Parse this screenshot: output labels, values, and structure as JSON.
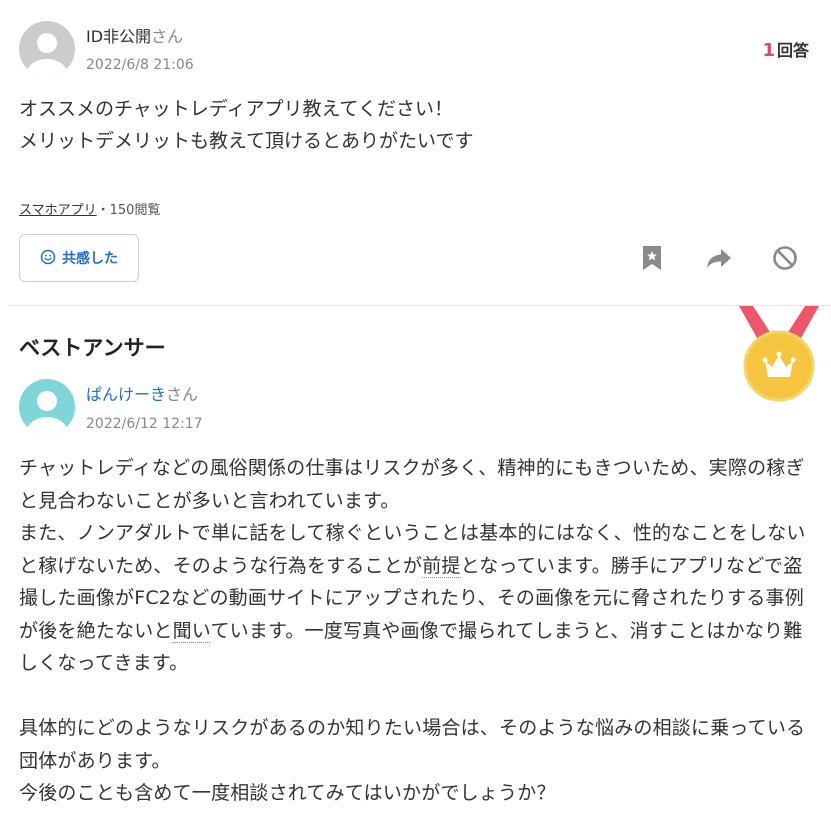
{
  "question": {
    "user_name": "ID非公開",
    "user_suffix": "さん",
    "date": "2022/6/8 21:06",
    "answer_count": "1",
    "answer_label": "回答",
    "body": "オススメのチャットレディアプリ教えてください！\nメリットデメリットも教えて頂けるとありがたいです",
    "category": "スマホアプリ",
    "separator": "・",
    "views": "150閲覧",
    "empathy_label": "共感した",
    "icons": [
      "bookmark-icon",
      "share-icon",
      "block-icon"
    ]
  },
  "best_answer": {
    "title": "ベストアンサー",
    "medal_icon": "crown-medal-icon",
    "user_name": "ぱんけーき",
    "user_suffix": "さん",
    "date": "2022/6/12 12:17",
    "paragraphs": {
      "p1": "チャットレディなどの風俗関係の仕事はリスクが多く、精神的にもきついため、実際の稼ぎと見合わないことが多いと言われています。",
      "p2_a": "また、ノンアダルトで単に話をして稼ぐということは基本的にはなく、性的なことをしないと稼げないため、そのような行為をすることが",
      "p2_link1": "前提",
      "p2_b": "となっています。勝手にアプリなどで盗撮した画像がFC2などの動画サイトにアップされたり、その画像を元に脅されたりする事例が後を絶たないと",
      "p2_link2": "聞い",
      "p2_c": "ています。一度写真や画像で撮られてしまうと、消すことはかなり難しくなってきます。",
      "p3": "具体的にどのようなリスクがあるのか知りたい場合は、そのような悩みの相談に乗っている団体があります。",
      "p4": "今後のことも含めて一度相談されてみてはいかがでしょうか？"
    }
  },
  "colors": {
    "accent_red": "#e0455d",
    "link_blue": "#1f6fc5",
    "medal_gold": "#f5c53f",
    "medal_ribbon": "#f0566a",
    "answer_avatar": "#7fd6d8",
    "question_avatar": "#cccccc"
  }
}
